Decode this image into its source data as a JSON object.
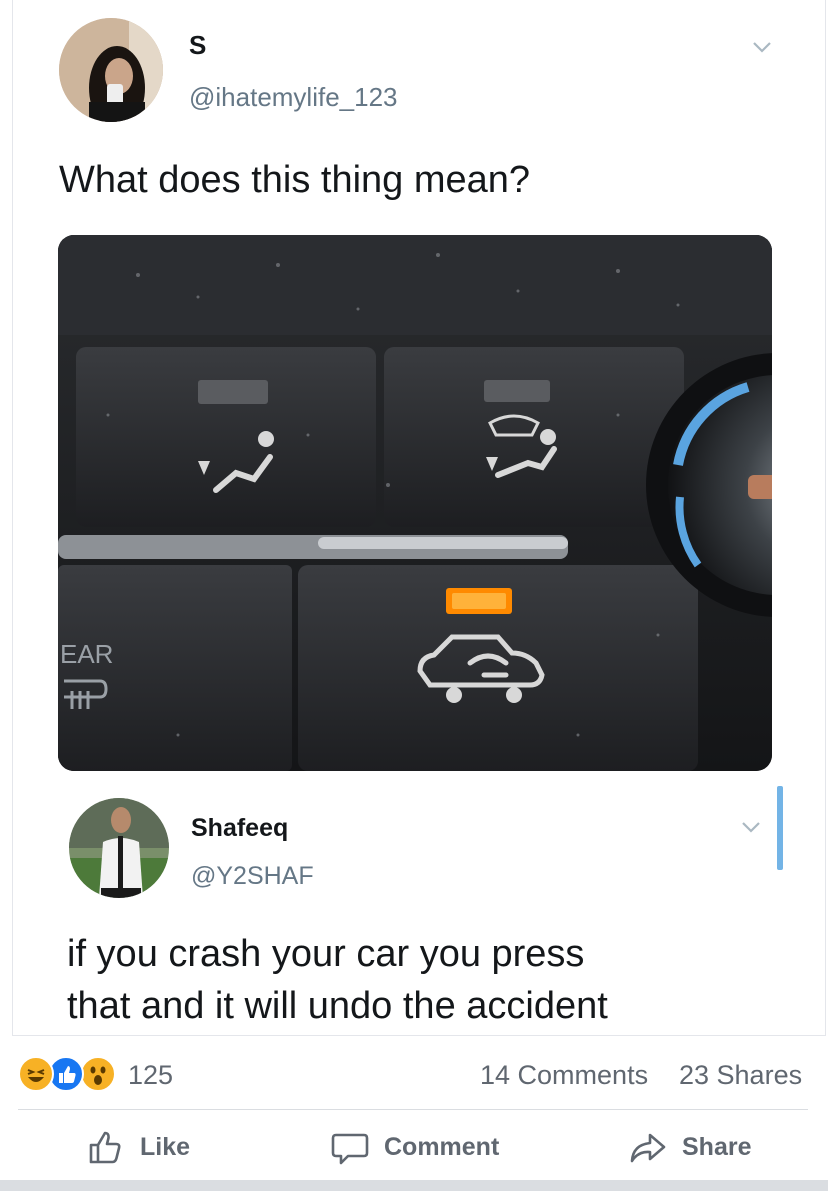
{
  "tweet": {
    "name": "S",
    "handle": "@ihatemylife_123",
    "text": "What does this thing mean?"
  },
  "reply": {
    "name": "Shafeeq",
    "handle": "@Y2SHAF",
    "text_line1": "if you crash your car you press",
    "text_line2": "that and it will undo the accident"
  },
  "photo": {
    "panel_label": "EAR"
  },
  "post_stats": {
    "reaction_count": "125",
    "comments": "14 Comments",
    "shares": "23 Shares"
  },
  "actions": {
    "like": "Like",
    "comment": "Comment",
    "share": "Share"
  },
  "colors": {
    "accent": "#1877f2",
    "text_muted": "#606770",
    "indicator": "#ff8a00",
    "scroll": "#73b4e6"
  },
  "icons": [
    "chevron-down-icon",
    "like-icon",
    "comment-icon",
    "share-icon",
    "haha-reaction-icon",
    "like-reaction-icon",
    "wow-reaction-icon"
  ]
}
